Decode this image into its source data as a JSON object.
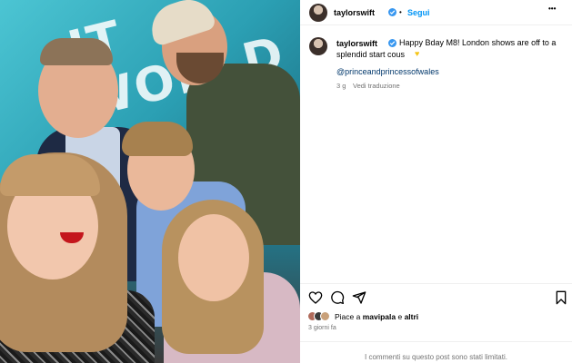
{
  "post": {
    "username": "taylorswift",
    "follow_label": "Segui",
    "separator": "•",
    "more_label": "•••",
    "caption_username": "taylorswift",
    "caption_line1": "Happy Bday M8! London shows are off to a",
    "caption_line2": "splendid start cous",
    "mention": "@princeandprincessofwales",
    "age": "3 g",
    "see_translation": "Vedi traduzione",
    "likes_prefix": "Piace a ",
    "likes_user": "mavipala",
    "likes_joiner": " e ",
    "likes_others": "altri",
    "posted_ago": "3 giorni fa",
    "comments_limited": "I commenti su questo post sono stati limitati."
  },
  "photo": {
    "wall_text": "IT WORLD"
  },
  "colors": {
    "accent": "#0095f6",
    "verified": "#3897f0",
    "mention": "#00376b",
    "muted": "#737373"
  },
  "icons": [
    "heart-icon",
    "comment-icon",
    "share-icon",
    "bookmark-icon",
    "verified-icon",
    "more-icon"
  ]
}
